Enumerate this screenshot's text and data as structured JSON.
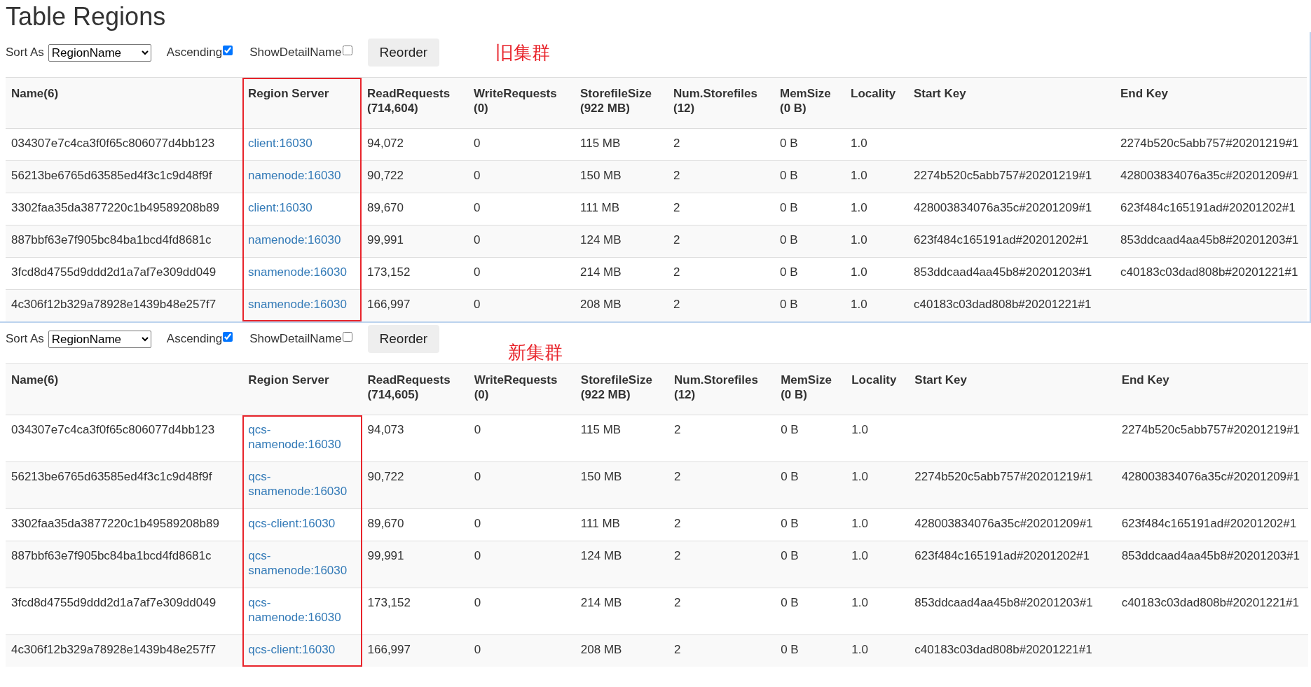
{
  "title": "Table Regions",
  "panels": [
    {
      "annotation": "旧集群",
      "controls": {
        "sort_label": "Sort As",
        "sort_value": "RegionName",
        "options": [
          {
            "label": "Ascending",
            "checked": true
          },
          {
            "label": "ShowDetailName",
            "checked": false
          }
        ],
        "button": "Reorder"
      },
      "table": {
        "columns": [
          {
            "title": "Name(6)",
            "kind": "text"
          },
          {
            "title": "Region Server",
            "kind": "link",
            "highlighted": true,
            "highlight_header": true
          },
          {
            "title": "ReadRequests (714,604)",
            "kind": "text"
          },
          {
            "title": "WriteRequests (0)",
            "kind": "text"
          },
          {
            "title": "StorefileSize (922 MB)",
            "kind": "text"
          },
          {
            "title": "Num.Storefiles (12)",
            "kind": "text"
          },
          {
            "title": "MemSize (0 B)",
            "kind": "text"
          },
          {
            "title": "Locality",
            "kind": "text"
          },
          {
            "title": "Start Key",
            "kind": "text"
          },
          {
            "title": "End Key",
            "kind": "text"
          }
        ],
        "rows": [
          [
            "034307e7c4ca3f0f65c806077d4bb123",
            "client:16030",
            "94,072",
            "0",
            "115 MB",
            "2",
            "0 B",
            "1.0",
            null,
            "2274b520c5abb757#20201219#1"
          ],
          [
            "56213be6765d63585ed4f3c1c9d48f9f",
            "namenode:16030",
            "90,722",
            "0",
            "150 MB",
            "2",
            "0 B",
            "1.0",
            "2274b520c5abb757#20201219#1",
            "428003834076a35c#20201209#1"
          ],
          [
            "3302faa35da3877220c1b49589208b89",
            "client:16030",
            "89,670",
            "0",
            "111 MB",
            "2",
            "0 B",
            "1.0",
            "428003834076a35c#20201209#1",
            "623f484c165191ad#20201202#1"
          ],
          [
            "887bbf63e7f905bc84ba1bcd4fd8681c",
            "namenode:16030",
            "99,991",
            "0",
            "124 MB",
            "2",
            "0 B",
            "1.0",
            "623f484c165191ad#20201202#1",
            "853ddcaad4aa45b8#20201203#1"
          ],
          [
            "3fcd8d4755d9ddd2d1a7af7e309dd049",
            "snamenode:16030",
            "173,152",
            "0",
            "214 MB",
            "2",
            "0 B",
            "1.0",
            "853ddcaad4aa45b8#20201203#1",
            "c40183c03dad808b#20201221#1"
          ],
          [
            "4c306f12b329a78928e1439b48e257f7",
            "snamenode:16030",
            "166,997",
            "0",
            "208 MB",
            "2",
            "0 B",
            "1.0",
            "c40183c03dad808b#20201221#1",
            null
          ]
        ]
      }
    },
    {
      "annotation": "新集群",
      "controls": {
        "sort_label": "Sort As",
        "sort_value": "RegionName",
        "options": [
          {
            "label": "Ascending",
            "checked": true
          },
          {
            "label": "ShowDetailName",
            "checked": false
          }
        ],
        "button": "Reorder"
      },
      "table": {
        "columns": [
          {
            "title": "Name(6)",
            "kind": "text"
          },
          {
            "title": "Region Server",
            "kind": "link",
            "highlighted": true,
            "highlight_header": false
          },
          {
            "title": "ReadRequests (714,605)",
            "kind": "text"
          },
          {
            "title": "WriteRequests (0)",
            "kind": "text"
          },
          {
            "title": "StorefileSize (922 MB)",
            "kind": "text"
          },
          {
            "title": "Num.Storefiles (12)",
            "kind": "text"
          },
          {
            "title": "MemSize (0 B)",
            "kind": "text"
          },
          {
            "title": "Locality",
            "kind": "text"
          },
          {
            "title": "Start Key",
            "kind": "text"
          },
          {
            "title": "End Key",
            "kind": "text"
          }
        ],
        "rows": [
          [
            "034307e7c4ca3f0f65c806077d4bb123",
            "qcs-namenode:16030",
            "94,073",
            "0",
            "115 MB",
            "2",
            "0 B",
            "1.0",
            null,
            "2274b520c5abb757#20201219#1"
          ],
          [
            "56213be6765d63585ed4f3c1c9d48f9f",
            "qcs-snamenode:16030",
            "90,722",
            "0",
            "150 MB",
            "2",
            "0 B",
            "1.0",
            "2274b520c5abb757#20201219#1",
            "428003834076a35c#20201209#1"
          ],
          [
            "3302faa35da3877220c1b49589208b89",
            "qcs-client:16030",
            "89,670",
            "0",
            "111 MB",
            "2",
            "0 B",
            "1.0",
            "428003834076a35c#20201209#1",
            "623f484c165191ad#20201202#1"
          ],
          [
            "887bbf63e7f905bc84ba1bcd4fd8681c",
            "qcs-snamenode:16030",
            "99,991",
            "0",
            "124 MB",
            "2",
            "0 B",
            "1.0",
            "623f484c165191ad#20201202#1",
            "853ddcaad4aa45b8#20201203#1"
          ],
          [
            "3fcd8d4755d9ddd2d1a7af7e309dd049",
            "qcs-namenode:16030",
            "173,152",
            "0",
            "214 MB",
            "2",
            "0 B",
            "1.0",
            "853ddcaad4aa45b8#20201203#1",
            "c40183c03dad808b#20201221#1"
          ],
          [
            "4c306f12b329a78928e1439b48e257f7",
            "qcs-client:16030",
            "166,997",
            "0",
            "208 MB",
            "2",
            "0 B",
            "1.0",
            "c40183c03dad808b#20201221#1",
            null
          ]
        ]
      }
    }
  ]
}
